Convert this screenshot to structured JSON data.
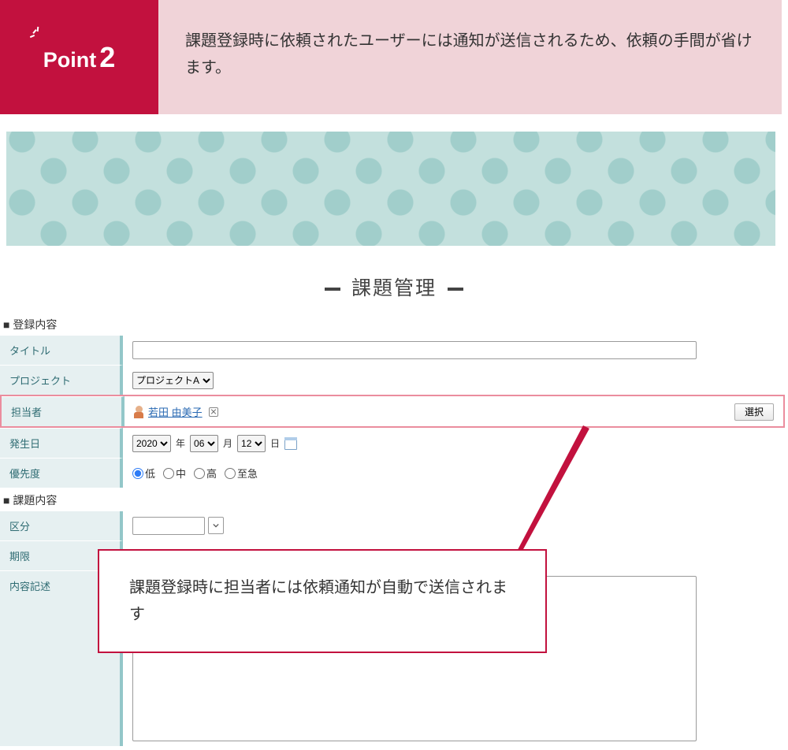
{
  "point": {
    "label": "Point",
    "number": "2",
    "text": "課題登録時に依頼されたユーザーには通知が送信されるため、依頼の手間が省けます。"
  },
  "page_title": "課題管理",
  "sections": {
    "s1": "■ 登録内容",
    "s2": "■ 課題内容"
  },
  "fields": {
    "title_label": "タイトル",
    "title_value": "",
    "project_label": "プロジェクト",
    "project_value": "プロジェクトA",
    "assignee_label": "担当者",
    "assignee_name": "若田 由美子",
    "select_btn": "選択",
    "date_label": "発生日",
    "year": "2020",
    "y_suf": "年",
    "month": "06",
    "m_suf": "月",
    "day": "12",
    "d_suf": "日",
    "priority_label": "優先度",
    "prio": {
      "low": "低",
      "mid": "中",
      "high": "高",
      "urgent": "至急"
    },
    "category_label": "区分",
    "category_value": "",
    "deadline_label": "期限",
    "desc_label": "内容記述"
  },
  "callout_text": "課題登録時に担当者には依頼通知が自動で送信されます"
}
